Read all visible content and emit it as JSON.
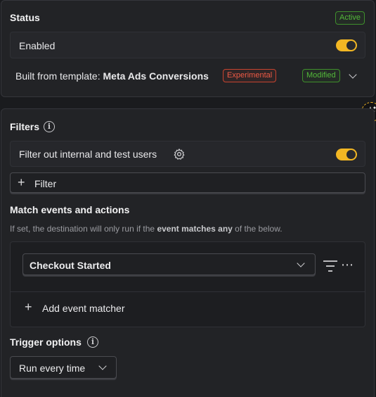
{
  "status": {
    "title": "Status",
    "active_badge": "Active",
    "enabled_label": "Enabled",
    "enabled_on": true,
    "template_prefix": "Built from template: ",
    "template_name": "Meta Ads Conversions",
    "experimental_badge": "Experimental",
    "modified_badge": "Modified"
  },
  "filters": {
    "title": "Filters",
    "internal_label": "Filter out internal and test users",
    "internal_on": true,
    "add_filter_label": "Filter"
  },
  "match": {
    "title": "Match events and actions",
    "desc_prefix": "If set, the destination will only run if the ",
    "desc_bold": "event matches any",
    "desc_suffix": " of the below.",
    "event_value": "Checkout Started",
    "add_matcher_label": "Add event matcher"
  },
  "trigger": {
    "title": "Trigger options",
    "select_value": "Run every time"
  },
  "colors": {
    "accent_toggle": "#f3b723",
    "badge_green": "#53b93a",
    "badge_red": "#ee5a45"
  }
}
